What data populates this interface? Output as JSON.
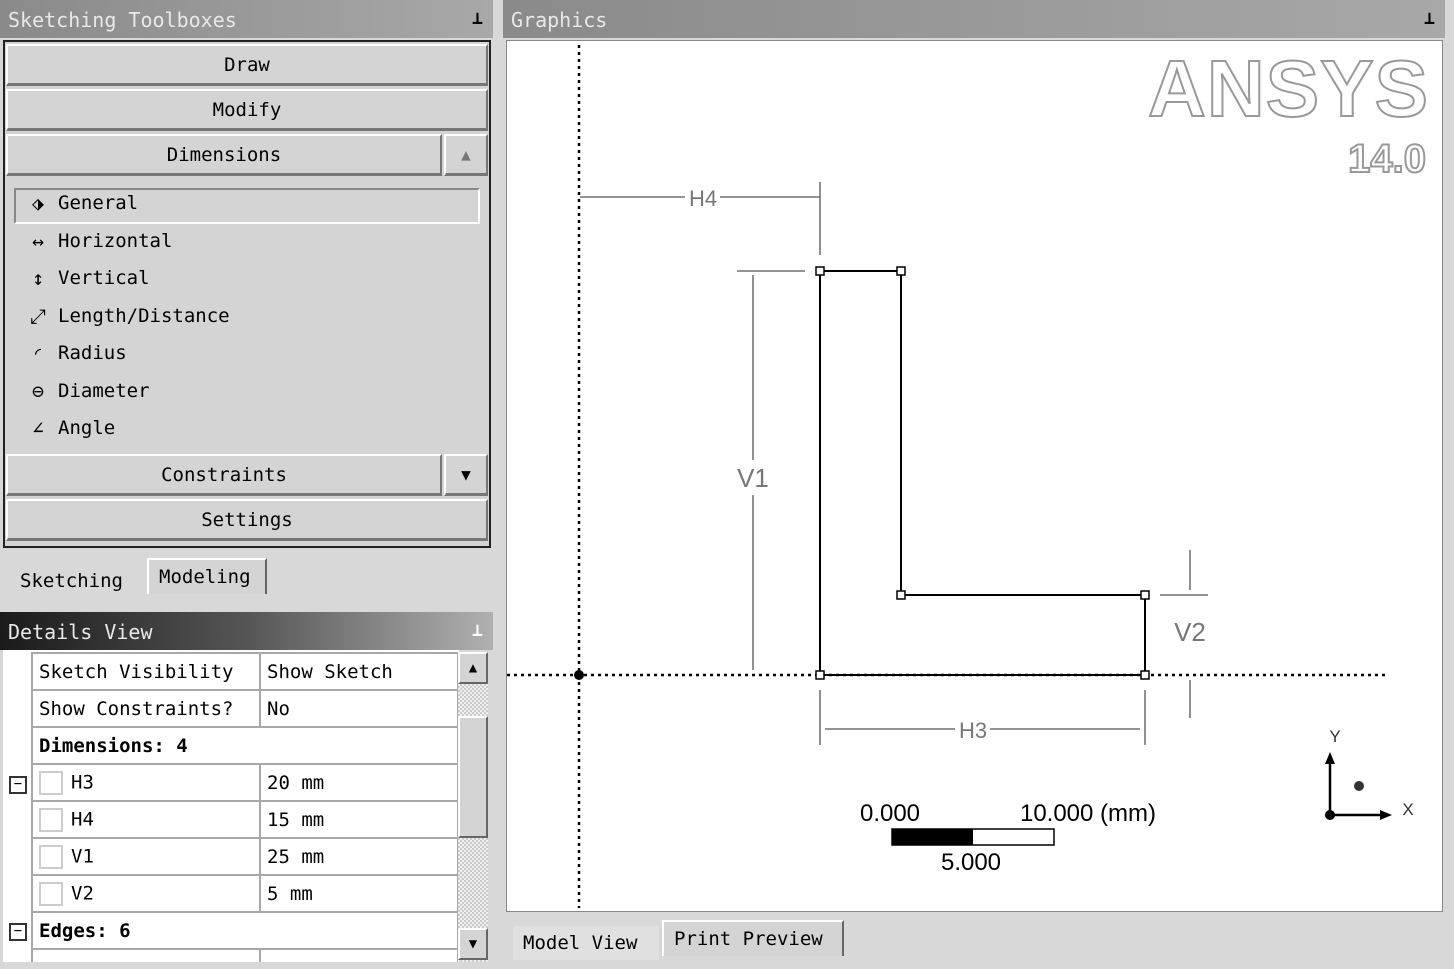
{
  "toolbox": {
    "title": "Sketching Toolboxes",
    "sections": {
      "draw": "Draw",
      "modify": "Modify",
      "dimensions": "Dimensions",
      "constraints": "Constraints",
      "settings": "Settings"
    },
    "items": [
      {
        "label": "General",
        "icon": "general-dimension-icon",
        "glyph": "⬗"
      },
      {
        "label": "Horizontal",
        "icon": "horizontal-dimension-icon",
        "glyph": "↔"
      },
      {
        "label": "Vertical",
        "icon": "vertical-dimension-icon",
        "glyph": "↕"
      },
      {
        "label": "Length/Distance",
        "icon": "length-distance-icon",
        "glyph": "⤢"
      },
      {
        "label": "Radius",
        "icon": "radius-icon",
        "glyph": "◜"
      },
      {
        "label": "Diameter",
        "icon": "diameter-icon",
        "glyph": "⊖"
      },
      {
        "label": "Angle",
        "icon": "angle-icon",
        "glyph": "∠"
      }
    ],
    "tabs": [
      "Sketching",
      "Modeling"
    ]
  },
  "details": {
    "title": "Details View",
    "rows": [
      {
        "name": "Sketch Visibility",
        "value": "Show Sketch"
      },
      {
        "name": "Show Constraints?",
        "value": "No"
      }
    ],
    "dimensions_header": "Dimensions: 4",
    "dimensions": [
      {
        "name": "H3",
        "value": "20 mm"
      },
      {
        "name": "H4",
        "value": "15 mm"
      },
      {
        "name": "V1",
        "value": "25 mm"
      },
      {
        "name": "V2",
        "value": "5 mm"
      }
    ],
    "edges_header": "Edges: 6"
  },
  "graphics": {
    "title": "Graphics",
    "logo": "ANSYS",
    "version": "14.0",
    "labels": {
      "h4": "H4",
      "v1": "V1",
      "v2": "V2",
      "h3": "H3"
    },
    "scale": {
      "start": "0.000",
      "mid": "5.000",
      "end": "10.000 (mm)"
    },
    "axes": {
      "x": "X",
      "y": "Y"
    },
    "tabs": [
      "Model View",
      "Print Preview"
    ]
  }
}
